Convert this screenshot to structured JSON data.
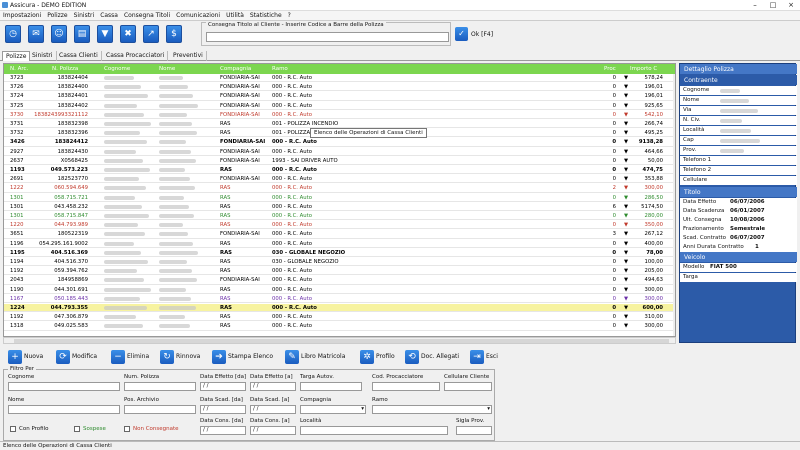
{
  "window": {
    "title": "Assicura - DEMO EDITION"
  },
  "menu": [
    "Impostazioni",
    "Polizze",
    "Sinistri",
    "Cassa",
    "Consegna Titoli",
    "Comunicazioni",
    "Utilità",
    "Statistiche",
    "?"
  ],
  "toolbar_icons": [
    "clock-icon",
    "mail-icon",
    "user-icon",
    "document-icon",
    "filter-icon",
    "trash-icon",
    "chart-icon",
    "dollar-icon"
  ],
  "consegna": {
    "label": "Consegna Titolo al Cliente - Inserire Codice a Barre della Polizza",
    "value": "",
    "ok_label": "Ok [F4]"
  },
  "tabs": [
    "Polizze",
    "Sinistri",
    "Cassa Clienti",
    "Cassa Procacciatori",
    "Preventivi"
  ],
  "grid": {
    "columns": [
      "N. Arc.",
      "N. Polizza",
      "Cognome",
      "Nome",
      "Compagnia",
      "Ramo",
      "Proc",
      "Importo C"
    ],
    "rows": [
      {
        "arc": "3723",
        "pol": "183824404",
        "comp": "FONDIARIA-SAI",
        "ramo": "000 - R.C. Auto",
        "proc": "0",
        "imp": "578,24",
        "color": "#000",
        "bold": false,
        "bg": "#fff"
      },
      {
        "arc": "3726",
        "pol": "183824400",
        "comp": "FONDIARIA-SAI",
        "ramo": "000 - R.C. Auto",
        "proc": "0",
        "imp": "196,01",
        "color": "#000",
        "bold": false,
        "bg": "#fff"
      },
      {
        "arc": "3724",
        "pol": "183824401",
        "comp": "FONDIARIA-SAI",
        "ramo": "000 - R.C. Auto",
        "proc": "0",
        "imp": "196,01",
        "color": "#000",
        "bold": false,
        "bg": "#fff"
      },
      {
        "arc": "3725",
        "pol": "183824402",
        "comp": "FONDIARIA-SAI",
        "ramo": "000 - R.C. Auto",
        "proc": "0",
        "imp": "925,65",
        "color": "#000",
        "bold": false,
        "bg": "#fff"
      },
      {
        "arc": "3730",
        "pol": "1838243993321112",
        "comp": "FONDIARIA-SAI",
        "ramo": "000 - R.C. Auto",
        "proc": "0",
        "imp": "542,10",
        "color": "#c0392b",
        "bold": false,
        "bg": "#fff"
      },
      {
        "arc": "3731",
        "pol": "183832398",
        "comp": "RAS",
        "ramo": "001 - POLIZZA INCENDIO",
        "proc": "0",
        "imp": "266,74",
        "color": "#000",
        "bold": false,
        "bg": "#fff"
      },
      {
        "arc": "3732",
        "pol": "183832396",
        "comp": "RAS",
        "ramo": "001 - POLIZZA I",
        "proc": "0",
        "imp": "495,25",
        "color": "#000",
        "bold": false,
        "bg": "#fff"
      },
      {
        "arc": "3426",
        "pol": "183824412",
        "comp": "FONDIARIA-SAI",
        "ramo": "000 - R.C. Auto",
        "proc": "0",
        "imp": "9138,28",
        "color": "#000",
        "bold": true,
        "bg": "#fff"
      },
      {
        "arc": "2927",
        "pol": "183824430",
        "comp": "FONDIARIA-SAI",
        "ramo": "000 - R.C. Auto",
        "proc": "0",
        "imp": "464,66",
        "color": "#000",
        "bold": false,
        "bg": "#fff"
      },
      {
        "arc": "2637",
        "pol": "X0568425",
        "comp": "FONDIARIA-SAI",
        "ramo": "1993 - SAI DRIVER AUTO",
        "proc": "0",
        "imp": "50,00",
        "color": "#000",
        "bold": false,
        "bg": "#fff"
      },
      {
        "arc": "1193",
        "pol": "049.573.223",
        "comp": "RAS",
        "ramo": "000 - R.C. Auto",
        "proc": "0",
        "imp": "474,75",
        "color": "#000",
        "bold": true,
        "bg": "#fff"
      },
      {
        "arc": "2691",
        "pol": "182523770",
        "comp": "FONDIARIA-SAI",
        "ramo": "000 - R.C. Auto",
        "proc": "0",
        "imp": "353,88",
        "color": "#000",
        "bold": false,
        "bg": "#fff"
      },
      {
        "arc": "1222",
        "pol": "060.594.649",
        "comp": "RAS",
        "ramo": "000 - R.C. Auto",
        "proc": "2",
        "imp": "300,00",
        "color": "#c0392b",
        "bold": false,
        "bg": "#fff"
      },
      {
        "arc": "1301",
        "pol": "058.715.721",
        "comp": "RAS",
        "ramo": "000 - R.C. Auto",
        "proc": "0",
        "imp": "286,50",
        "color": "#2e8b2e",
        "bold": false,
        "bg": "#fff"
      },
      {
        "arc": "1301",
        "pol": "043.458.232",
        "comp": "RAS",
        "ramo": "000 - R.C. Auto",
        "proc": "6",
        "imp": "5174,50",
        "color": "#000",
        "bold": false,
        "bg": "#fff"
      },
      {
        "arc": "1301",
        "pol": "058.715.847",
        "comp": "RAS",
        "ramo": "000 - R.C. Auto",
        "proc": "0",
        "imp": "280,00",
        "color": "#2e8b2e",
        "bold": false,
        "bg": "#fff"
      },
      {
        "arc": "1220",
        "pol": "044.793.989",
        "comp": "RAS",
        "ramo": "000 - R.C. Auto",
        "proc": "0",
        "imp": "350,00",
        "color": "#c0392b",
        "bold": false,
        "bg": "#fff"
      },
      {
        "arc": "3651",
        "pol": "180522319",
        "comp": "FONDIARIA-SAI",
        "ramo": "000 - R.C. Auto",
        "proc": "3",
        "imp": "267,12",
        "color": "#000",
        "bold": false,
        "bg": "#fff"
      },
      {
        "arc": "1196",
        "pol": "054.295.161.9002",
        "comp": "RAS",
        "ramo": "000 - R.C. Auto",
        "proc": "0",
        "imp": "400,00",
        "color": "#000",
        "bold": false,
        "bg": "#fff"
      },
      {
        "arc": "1195",
        "pol": "404.516.369",
        "comp": "RAS",
        "ramo": "030 - GLOBALE NEGOZIO",
        "proc": "0",
        "imp": "78,00",
        "color": "#000",
        "bold": true,
        "bg": "#fff"
      },
      {
        "arc": "1194",
        "pol": "404.516.370",
        "comp": "RAS",
        "ramo": "030 - GLOBALE NEGOZIO",
        "proc": "0",
        "imp": "100,00",
        "color": "#000",
        "bold": false,
        "bg": "#fff"
      },
      {
        "arc": "1192",
        "pol": "059.394.762",
        "comp": "RAS",
        "ramo": "000 - R.C. Auto",
        "proc": "0",
        "imp": "205,00",
        "color": "#000",
        "bold": false,
        "bg": "#fff"
      },
      {
        "arc": "2043",
        "pol": "184958869",
        "comp": "FONDIARIA-SAI",
        "ramo": "000 - R.C. Auto",
        "proc": "0",
        "imp": "494,63",
        "color": "#000",
        "bold": false,
        "bg": "#fff"
      },
      {
        "arc": "1190",
        "pol": "044.301.691",
        "comp": "RAS",
        "ramo": "000 - R.C. Auto",
        "proc": "0",
        "imp": "300,00",
        "color": "#000",
        "bold": false,
        "bg": "#fff"
      },
      {
        "arc": "1167",
        "pol": "050.185.443",
        "comp": "RAS",
        "ramo": "000 - R.C. Auto",
        "proc": "0",
        "imp": "300,00",
        "color": "#6a2fa8",
        "bold": false,
        "bg": "#fff"
      },
      {
        "arc": "1224",
        "pol": "044.793.355",
        "comp": "RAS",
        "ramo": "000 - R.C. Auto",
        "proc": "0",
        "imp": "600,00",
        "color": "#000",
        "bold": true,
        "bg": "#f7f3a0"
      },
      {
        "arc": "1192",
        "pol": "047.306.879",
        "comp": "RAS",
        "ramo": "000 - R.C. Auto",
        "proc": "0",
        "imp": "310,00",
        "color": "#000",
        "bold": false,
        "bg": "#fff"
      },
      {
        "arc": "1318",
        "pol": "049.025.583",
        "comp": "RAS",
        "ramo": "000 - R.C. Auto",
        "proc": "0",
        "imp": "300,00",
        "color": "#000",
        "bold": false,
        "bg": "#fff"
      }
    ],
    "tooltip": "Elenco delle Operazioni di Cassa Clienti"
  },
  "detail": {
    "title": "Dettaglio Polizza",
    "contraente": "Contraente",
    "contraente_fields": [
      "Cognome",
      "Nome",
      "Via",
      "N. Civ.",
      "Località",
      "Cap",
      "Prov.",
      "Telefono 1",
      "Telefono 2",
      "Cellulare"
    ],
    "titolo": "Titolo",
    "titolo_fields": [
      {
        "label": "Data Effetto",
        "value": "06/07/2006"
      },
      {
        "label": "Data Scadenza",
        "value": "06/01/2007"
      },
      {
        "label": "Ult. Consegna",
        "value": "10/08/2006"
      },
      {
        "label": "Frazionamento",
        "value": "Semestrale"
      },
      {
        "label": "Scad. Contratto",
        "value": "06/07/2007"
      },
      {
        "label": "Anni Durata Contratto",
        "value": "1"
      }
    ],
    "veicolo": "Veicolo",
    "veicolo_fields": [
      {
        "label": "Modello",
        "value": "FIAT 500"
      },
      {
        "label": "Targa",
        "value": ""
      }
    ]
  },
  "actions": [
    "Nuova",
    "Modifica",
    "Elimina",
    "Rinnova",
    "Stampa Elenco",
    "Libro Matricola",
    "Profilo",
    "Doc. Allegati",
    "Esci"
  ],
  "filtro": {
    "legend": "Filtro Per",
    "cognome": "Cognome",
    "num_polizza": "Num. Polizza",
    "data_effetto_da": "Data Effetto [da]",
    "data_effetto_a": "Data Effetto [a]",
    "targa": "Targa Autov.",
    "cod_proc": "Cod. Procacciatore",
    "cellulare": "Cellulare Cliente",
    "nome": "Nome",
    "pos_archivio": "Pos. Archivio",
    "data_scad_da": "Data Scad. [da]",
    "data_scad_a": "Data Scad. [a]",
    "compagnia": "Compagnia",
    "ramo": "Ramo",
    "data_cons_da": "Data Cons. [da]",
    "data_cons_a": "Data Cons. [a]",
    "localita": "Località",
    "sigla_prov": "Sigla Prov.",
    "con_profilo": "Con Profilo",
    "sospese": "Sospese",
    "non_consegnate": "Non Consegnate",
    "date_placeholder": " / / "
  },
  "status": "Elenco delle Operazioni di Cassa Clienti"
}
